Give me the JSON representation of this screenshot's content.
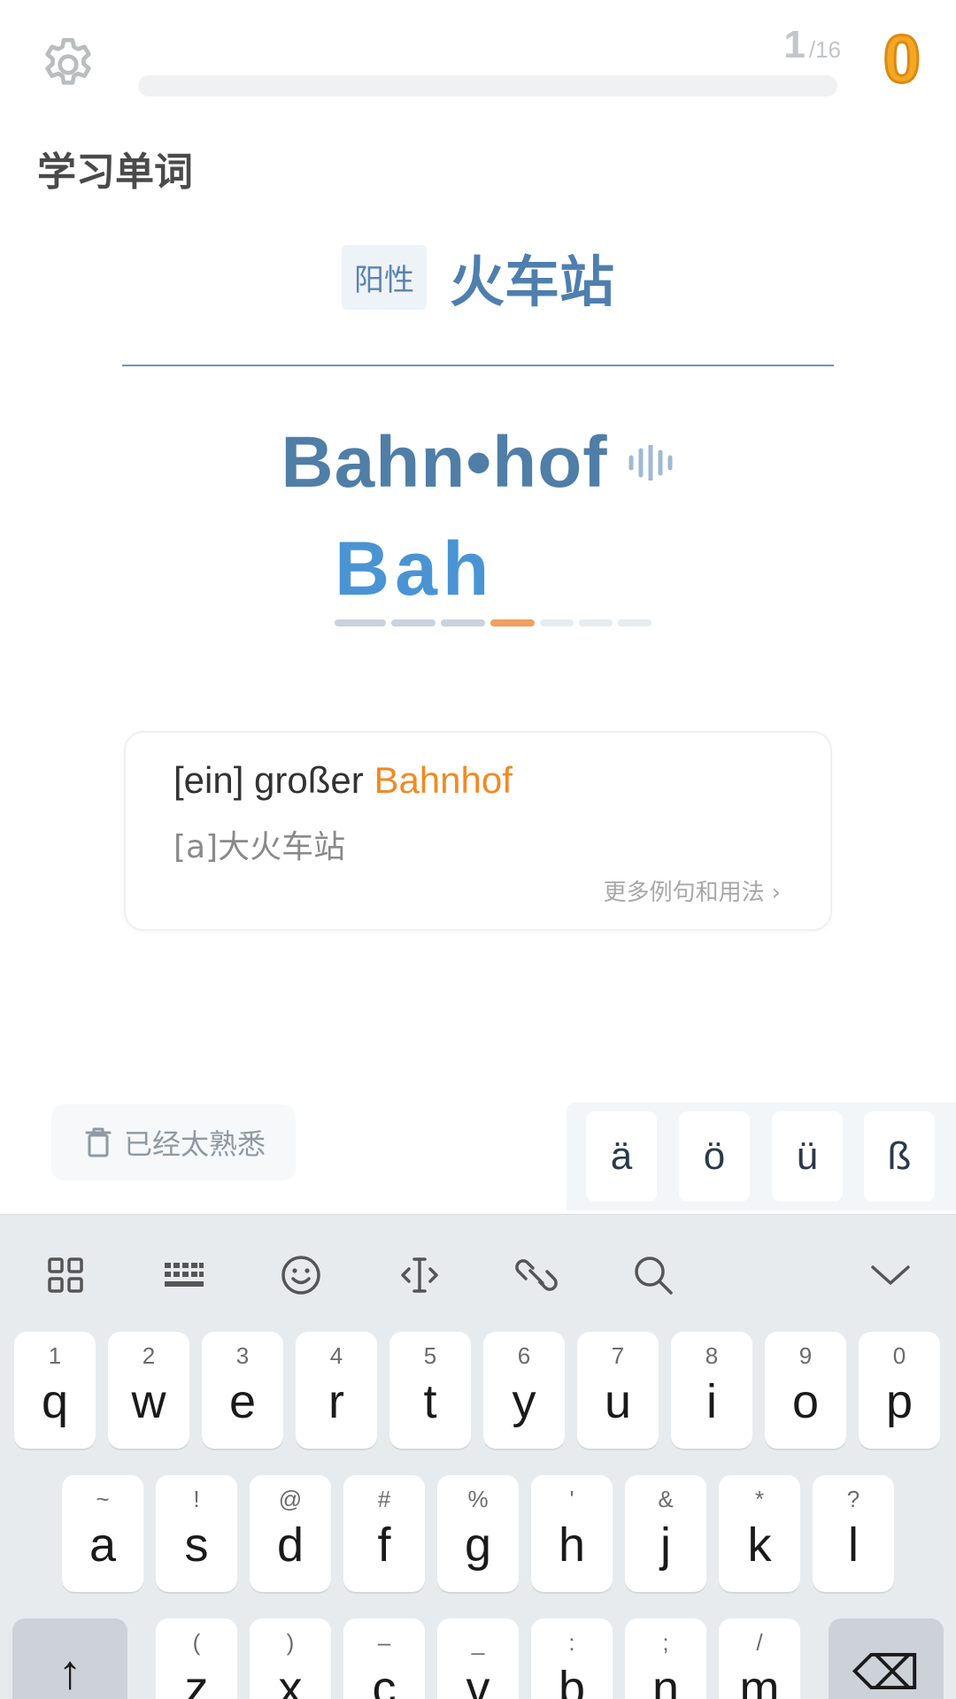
{
  "header": {
    "progress_current": "1",
    "progress_total": "/16",
    "progress_fraction": 0.0,
    "score": "0"
  },
  "section_title": "学习单词",
  "word": {
    "gender": "阳性",
    "meaning": "火车站",
    "german": "Bahn•hof",
    "typed": "Bah",
    "total_letters": 7,
    "typed_letters": 3
  },
  "example": {
    "prefix": "[ein] großer ",
    "highlight": "Bahnhof",
    "translation": "[a]大火车站",
    "more_label": "更多例句和用法",
    "more_chevron": "›"
  },
  "familiar_label": "已经太熟悉",
  "special_chars": [
    "ä",
    "ö",
    "ü",
    "ß"
  ],
  "keyboard": {
    "toolbar_icons": [
      "grid-icon",
      "keyboard-icon",
      "emoji-icon",
      "cursor-icon",
      "link-icon",
      "search-icon",
      "collapse-icon"
    ],
    "row1": [
      {
        "alt": "1",
        "key": "q"
      },
      {
        "alt": "2",
        "key": "w"
      },
      {
        "alt": "3",
        "key": "e"
      },
      {
        "alt": "4",
        "key": "r"
      },
      {
        "alt": "5",
        "key": "t"
      },
      {
        "alt": "6",
        "key": "y"
      },
      {
        "alt": "7",
        "key": "u"
      },
      {
        "alt": "8",
        "key": "i"
      },
      {
        "alt": "9",
        "key": "o"
      },
      {
        "alt": "0",
        "key": "p"
      }
    ],
    "row2": [
      {
        "alt": "~",
        "key": "a"
      },
      {
        "alt": "!",
        "key": "s"
      },
      {
        "alt": "@",
        "key": "d"
      },
      {
        "alt": "#",
        "key": "f"
      },
      {
        "alt": "%",
        "key": "g"
      },
      {
        "alt": "'",
        "key": "h"
      },
      {
        "alt": "&",
        "key": "j"
      },
      {
        "alt": "*",
        "key": "k"
      },
      {
        "alt": "?",
        "key": "l"
      }
    ],
    "row3": [
      {
        "alt": "(",
        "key": "z"
      },
      {
        "alt": ")",
        "key": "x"
      },
      {
        "alt": "–",
        "key": "c"
      },
      {
        "alt": "_",
        "key": "v"
      },
      {
        "alt": ":",
        "key": "b"
      },
      {
        "alt": ";",
        "key": "n"
      },
      {
        "alt": "/",
        "key": "m"
      }
    ],
    "shift_glyph": "↑",
    "delete_glyph": "⌫"
  }
}
